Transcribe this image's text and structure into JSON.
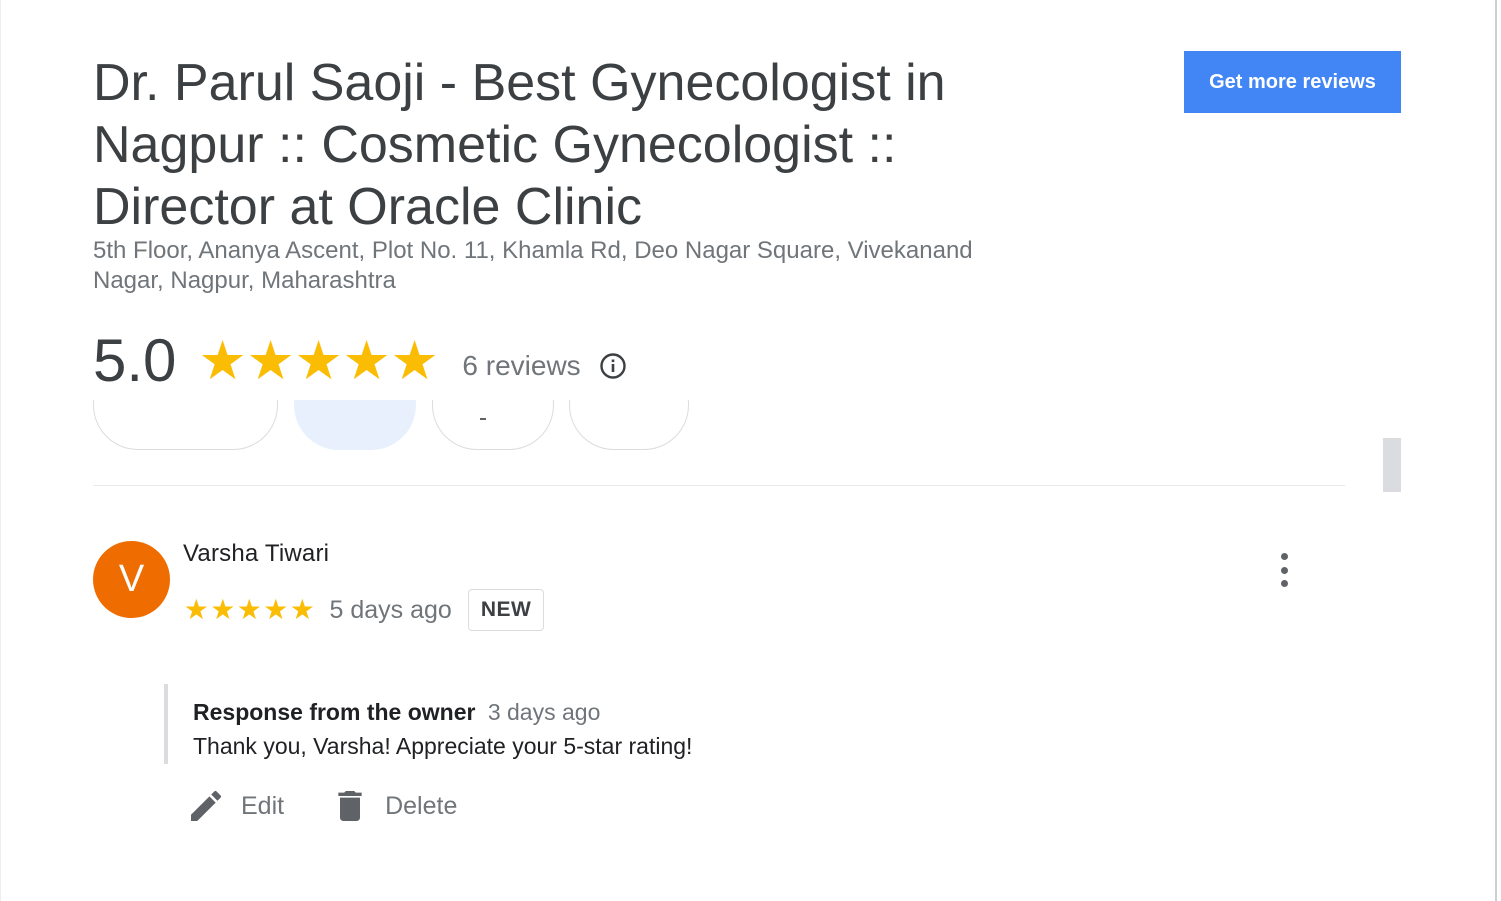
{
  "business": {
    "title_lines": [
      "Dr. Parul Saoji - Best Gynecologist in",
      "Nagpur :: Cosmetic Gynecologist ::",
      "Director at Oracle Clinic"
    ],
    "address_lines": [
      "5th Floor, Ananya Ascent, Plot No. 11, Khamla Rd, Deo Nagar Square, Vivekanand",
      "Nagar, Nagpur, Maharashtra"
    ]
  },
  "header": {
    "cta_label": "Get more reviews",
    "cta_color": "#4285f4"
  },
  "rating": {
    "score": "5.0",
    "stars": 5,
    "reviews_label": "6 reviews",
    "star_color": "#fbbc04",
    "info_icon": "info-icon"
  },
  "review": {
    "avatar_letter": "V",
    "avatar_color": "#ef6c00",
    "author": "Varsha Tiwari",
    "stars": 5,
    "time": "5 days ago",
    "badge": "NEW",
    "menu_icon": "more-vert-icon",
    "owner_response": {
      "label": "Response from the owner",
      "time": "3 days ago",
      "text": "Thank you, Varsha! Appreciate your 5-star rating!"
    },
    "actions": [
      {
        "label": "Edit",
        "icon": "pencil-icon"
      },
      {
        "label": "Delete",
        "icon": "trash-icon"
      }
    ]
  }
}
